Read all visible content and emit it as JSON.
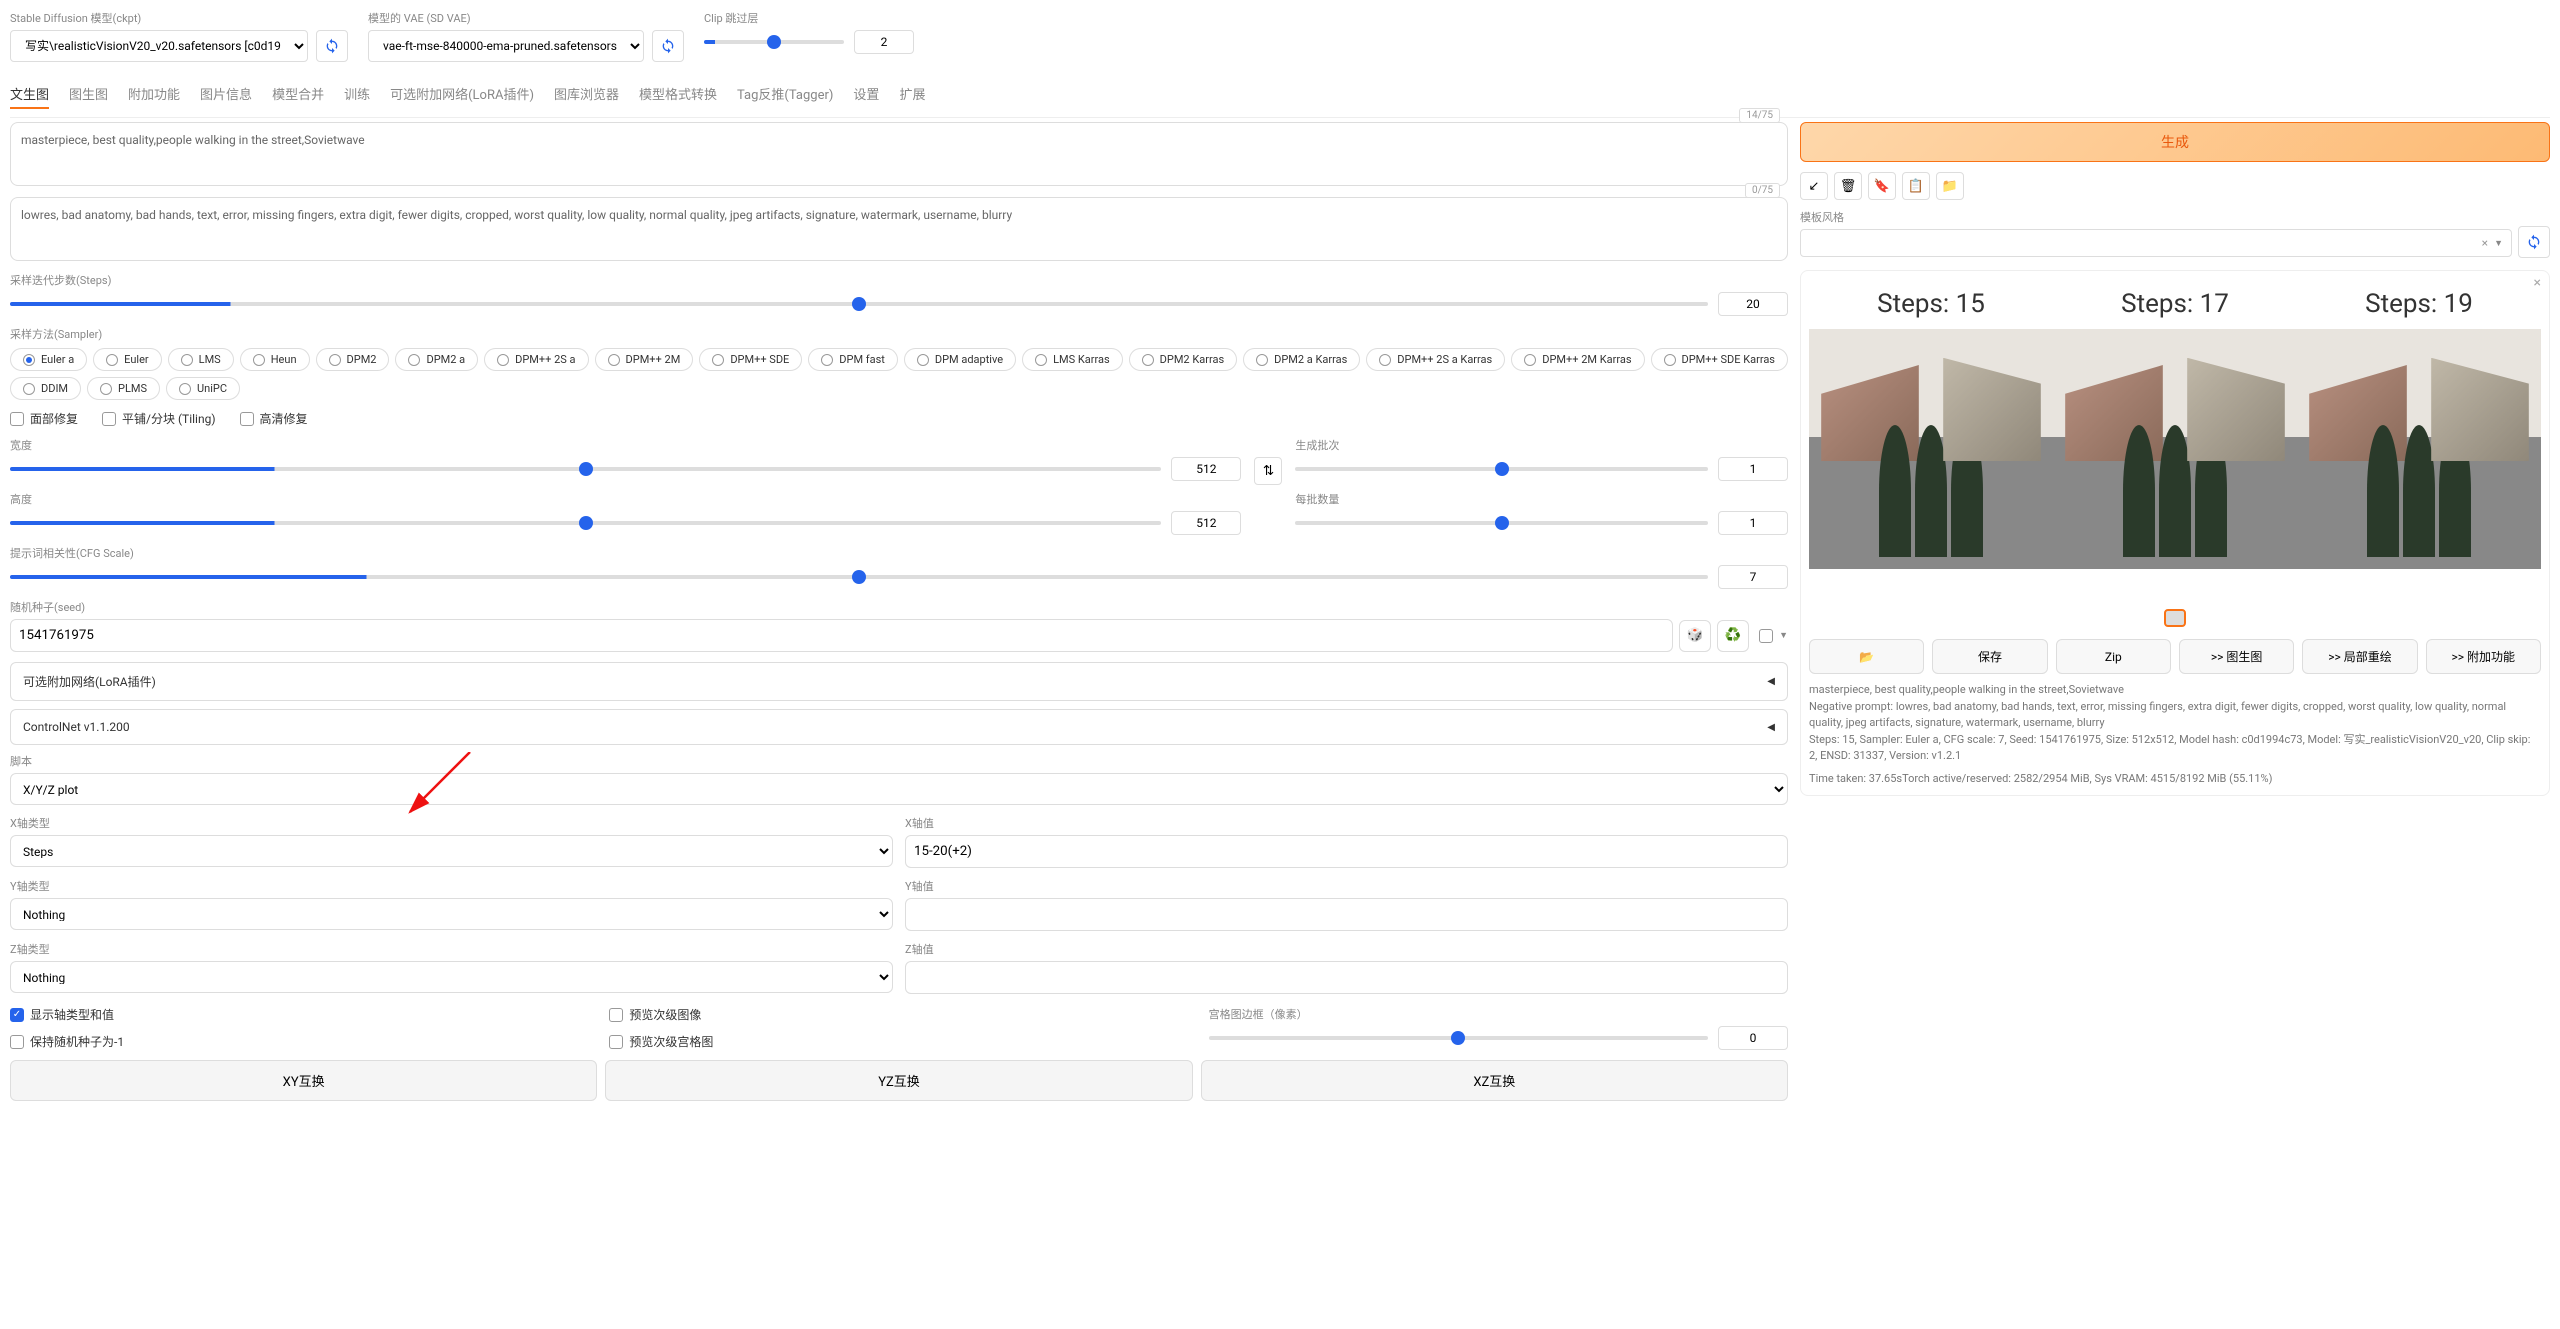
{
  "header": {
    "model_label": "Stable Diffusion 模型(ckpt)",
    "model_value": "写实\\realisticVisionV20_v20.safetensors [c0d19",
    "vae_label": "模型的 VAE (SD VAE)",
    "vae_value": "vae-ft-mse-840000-ema-pruned.safetensors",
    "clip_label": "Clip 跳过层",
    "clip_value": "2"
  },
  "tabs": [
    "文生图",
    "图生图",
    "附加功能",
    "图片信息",
    "模型合并",
    "训练",
    "可选附加网络(LoRA插件)",
    "图库浏览器",
    "模型格式转换",
    "Tag反推(Tagger)",
    "设置",
    "扩展"
  ],
  "active_tab": 0,
  "prompt": "masterpiece, best quality,people walking in the street,Sovietwave",
  "neg_prompt": "lowres, bad anatomy, bad hands, text, error, missing fingers, extra digit, fewer digits, cropped, worst quality, low quality, normal quality, jpeg artifacts, signature, watermark, username, blurry",
  "prompt_counter": "14/75",
  "neg_counter": "0/75",
  "generate": "生成",
  "template_label": "模板风格",
  "template_x": "×",
  "steps": {
    "label": "采样迭代步数(Steps)",
    "value": "20"
  },
  "sampler_label": "采样方法(Sampler)",
  "samplers": [
    "Euler a",
    "Euler",
    "LMS",
    "Heun",
    "DPM2",
    "DPM2 a",
    "DPM++ 2S a",
    "DPM++ 2M",
    "DPM++ SDE",
    "DPM fast",
    "DPM adaptive",
    "LMS Karras",
    "DPM2 Karras",
    "DPM2 a Karras",
    "DPM++ 2S a Karras",
    "DPM++ 2M Karras",
    "DPM++ SDE Karras",
    "DDIM",
    "PLMS",
    "UniPC"
  ],
  "sampler_selected": 0,
  "restore_faces": "面部修复",
  "tiling": "平铺/分块 (Tiling)",
  "hires": "高清修复",
  "width": {
    "label": "宽度",
    "value": "512"
  },
  "height": {
    "label": "高度",
    "value": "512"
  },
  "batch_count": {
    "label": "生成批次",
    "value": "1"
  },
  "batch_size": {
    "label": "每批数量",
    "value": "1"
  },
  "cfg": {
    "label": "提示词相关性(CFG Scale)",
    "value": "7"
  },
  "seed": {
    "label": "随机种子(seed)",
    "value": "1541761975"
  },
  "lora_accordion": "可选附加网络(LoRA插件)",
  "controlnet_accordion": "ControlNet v1.1.200",
  "script": {
    "label": "脚本",
    "value": "X/Y/Z plot"
  },
  "x_type": {
    "label": "X轴类型",
    "value": "Steps"
  },
  "x_values": {
    "label": "X轴值",
    "value": "15-20(+2)"
  },
  "y_type": {
    "label": "Y轴类型",
    "value": "Nothing"
  },
  "y_values": {
    "label": "Y轴值",
    "value": ""
  },
  "z_type": {
    "label": "Z轴类型",
    "value": "Nothing"
  },
  "z_values": {
    "label": "Z轴值",
    "value": ""
  },
  "draw_legend": "显示轴类型和值",
  "include_sub": "预览次级图像",
  "keep_seed": "保持随机种子为-1",
  "include_sub_grids": "预览次级宫格图",
  "grid_margins": {
    "label": "宫格图边框（像素）",
    "value": "0"
  },
  "swap_xy": "XY互换",
  "swap_yz": "YZ互换",
  "swap_xz": "XZ互换",
  "steps_grid": [
    "Steps: 15",
    "Steps: 17",
    "Steps: 19"
  ],
  "save_btn": "保存",
  "zip_btn": "Zip",
  "img2img_btn": ">> 图生图",
  "inpaint_btn": ">> 局部重绘",
  "extras_btn": ">> 附加功能",
  "info1": "masterpiece, best quality,people walking in the street,Sovietwave",
  "info2": "Negative prompt: lowres, bad anatomy, bad hands, text, error, missing fingers, extra digit, fewer digits, cropped, worst quality, low quality, normal quality, jpeg artifacts, signature, watermark, username, blurry",
  "info3": "Steps: 15, Sampler: Euler a, CFG scale: 7, Seed: 1541761975, Size: 512x512, Model hash: c0d1994c73, Model: 写实_realisticVisionV20_v20, Clip skip: 2, ENSD: 31337, Version: v1.2.1",
  "info4": "Time taken: 37.65sTorch active/reserved: 2582/2954 MiB, Sys VRAM: 4515/8192 MiB (55.11%)",
  "folder_icon": "📂",
  "swap_icon": "⇅",
  "dice_icon": "🎲",
  "recycle_icon": "♻️",
  "arrow_caret": "▼",
  "left_caret": "◀"
}
